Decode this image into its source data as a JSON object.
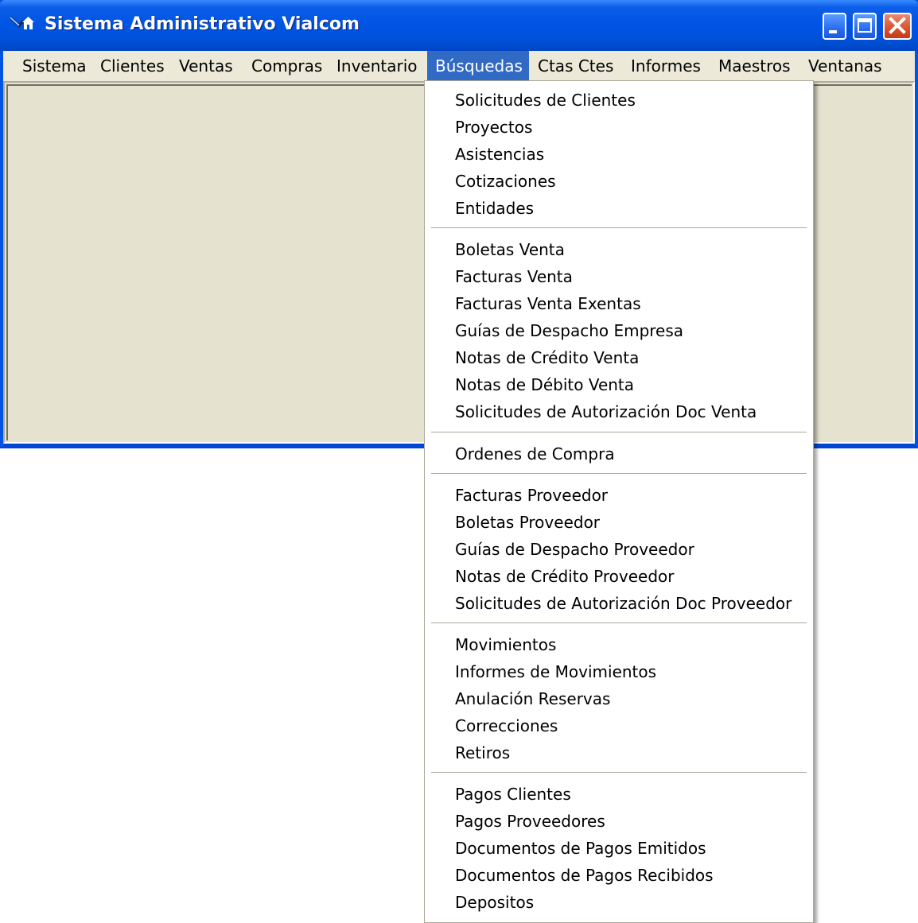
{
  "window": {
    "title": "Sistema Administrativo Vialcom"
  },
  "menubar": {
    "items": [
      {
        "label": "Sistema"
      },
      {
        "label": "Clientes"
      },
      {
        "label": "Ventas"
      },
      {
        "label": "Compras"
      },
      {
        "label": "Inventario"
      },
      {
        "label": "Búsquedas",
        "active": true
      },
      {
        "label": "Ctas Ctes"
      },
      {
        "label": "Informes"
      },
      {
        "label": "Maestros"
      },
      {
        "label": "Ventanas"
      }
    ]
  },
  "dropdown": {
    "groups": [
      [
        "Solicitudes de Clientes",
        "Proyectos",
        "Asistencias",
        "Cotizaciones",
        "Entidades"
      ],
      [
        "Boletas Venta",
        "Facturas Venta",
        "Facturas Venta Exentas",
        "Guías de Despacho Empresa",
        "Notas de Crédito Venta",
        "Notas de Débito Venta",
        "Solicitudes de Autorización Doc Venta"
      ],
      [
        "Ordenes de Compra"
      ],
      [
        "Facturas Proveedor",
        "Boletas Proveedor",
        "Guías de Despacho Proveedor",
        "Notas de Crédito Proveedor",
        "Solicitudes de Autorización Doc Proveedor"
      ],
      [
        "Movimientos",
        "Informes de Movimientos",
        "Anulación Reservas",
        "Correcciones",
        "Retiros"
      ],
      [
        "Pagos Clientes",
        "Pagos Proveedores",
        "Documentos de Pagos Emitidos",
        "Documentos de Pagos Recibidos",
        "Depositos"
      ]
    ]
  },
  "colors": {
    "title_bar": "#0055e5",
    "menu_highlight": "#316ac5",
    "face": "#ece9d8",
    "close_button": "#d8522c"
  }
}
